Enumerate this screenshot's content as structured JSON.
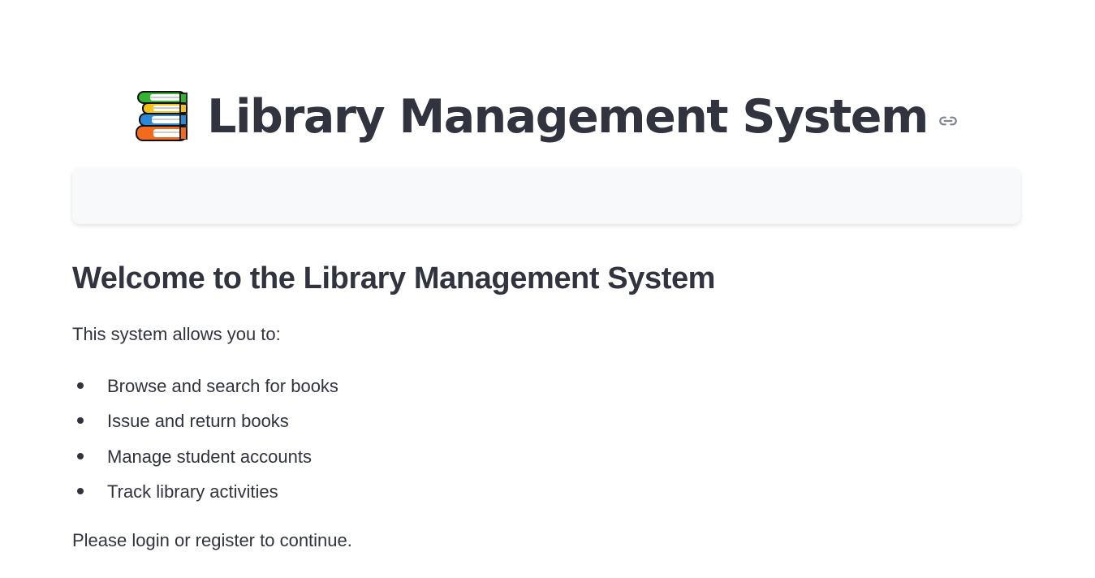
{
  "header": {
    "title": "Library Management System",
    "title_icon": "books-icon",
    "anchor_icon": "link-icon"
  },
  "info_box": {
    "text": ""
  },
  "content": {
    "welcome_heading": "Welcome to the Library Management System",
    "intro": "This system allows you to:",
    "features": [
      "Browse and search for books",
      "Issue and return books",
      "Manage student accounts",
      "Track library activities"
    ],
    "outro": "Please login or register to continue."
  },
  "colors": {
    "text": "#31333f",
    "info_box_bg": "#f8f9fb",
    "anchor_icon": "#808495"
  }
}
